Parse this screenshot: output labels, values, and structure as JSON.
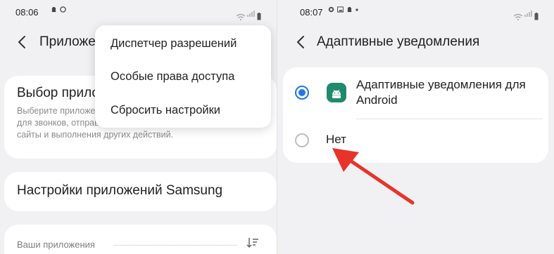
{
  "left": {
    "status": {
      "time": "08:06"
    },
    "appbar": {
      "title": "Приложения"
    },
    "menu": {
      "items": [
        "Диспетчер разрешений",
        "Особые права доступа",
        "Сбросить настройки"
      ]
    },
    "card1": {
      "title": "Выбор приложений по умолчанию",
      "desc": "Выберите приложения, которые будут использоваться для звонков, отправки сообщений, перехода на веб-сайты и выполнения других действий."
    },
    "card2": {
      "title": "Настройки приложений Samsung"
    },
    "section": {
      "label": "Ваши приложения"
    }
  },
  "right": {
    "status": {
      "time": "08:07"
    },
    "appbar": {
      "title": "Адаптивные уведомления"
    },
    "options": [
      {
        "label": "Адаптивные уведомления для Android",
        "selected": true,
        "icon": "android-icon"
      },
      {
        "label": "Нет",
        "selected": false
      }
    ]
  },
  "colors": {
    "accent": "#1f78e6",
    "arrow": "#e8332a",
    "android_icon": "#1f8a6e"
  }
}
